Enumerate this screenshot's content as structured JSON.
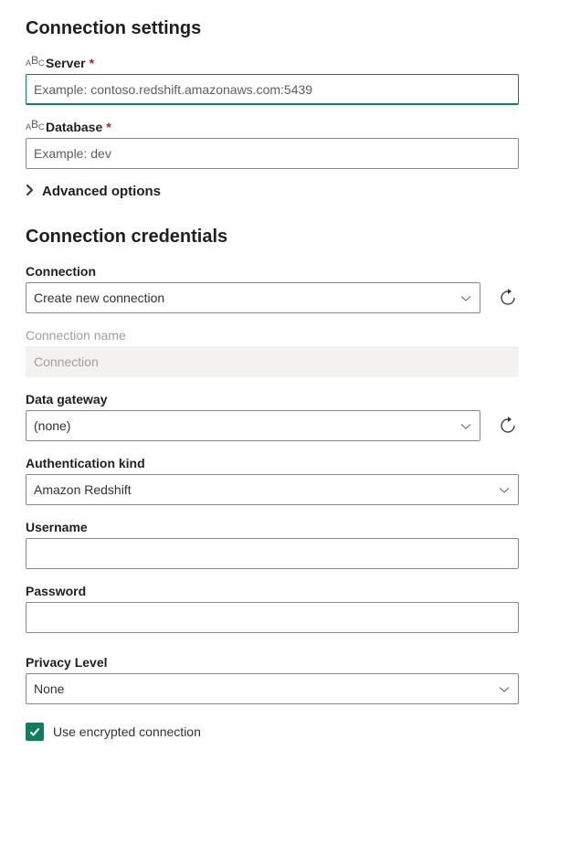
{
  "settings": {
    "heading": "Connection settings",
    "server": {
      "label": "Server",
      "placeholder": "Example: contoso.redshift.amazonaws.com:5439",
      "value": ""
    },
    "database": {
      "label": "Database",
      "placeholder": "Example: dev",
      "value": ""
    },
    "advanced": {
      "label": "Advanced options"
    }
  },
  "credentials": {
    "heading": "Connection credentials",
    "connection": {
      "label": "Connection",
      "value": "Create new connection"
    },
    "connection_name": {
      "label": "Connection name",
      "placeholder": "Connection",
      "value": ""
    },
    "data_gateway": {
      "label": "Data gateway",
      "value": "(none)"
    },
    "auth_kind": {
      "label": "Authentication kind",
      "value": "Amazon Redshift"
    },
    "username": {
      "label": "Username",
      "value": ""
    },
    "password": {
      "label": "Password",
      "value": ""
    },
    "privacy": {
      "label": "Privacy Level",
      "value": "None"
    },
    "encrypted": {
      "label": "Use encrypted connection",
      "checked": true
    }
  }
}
